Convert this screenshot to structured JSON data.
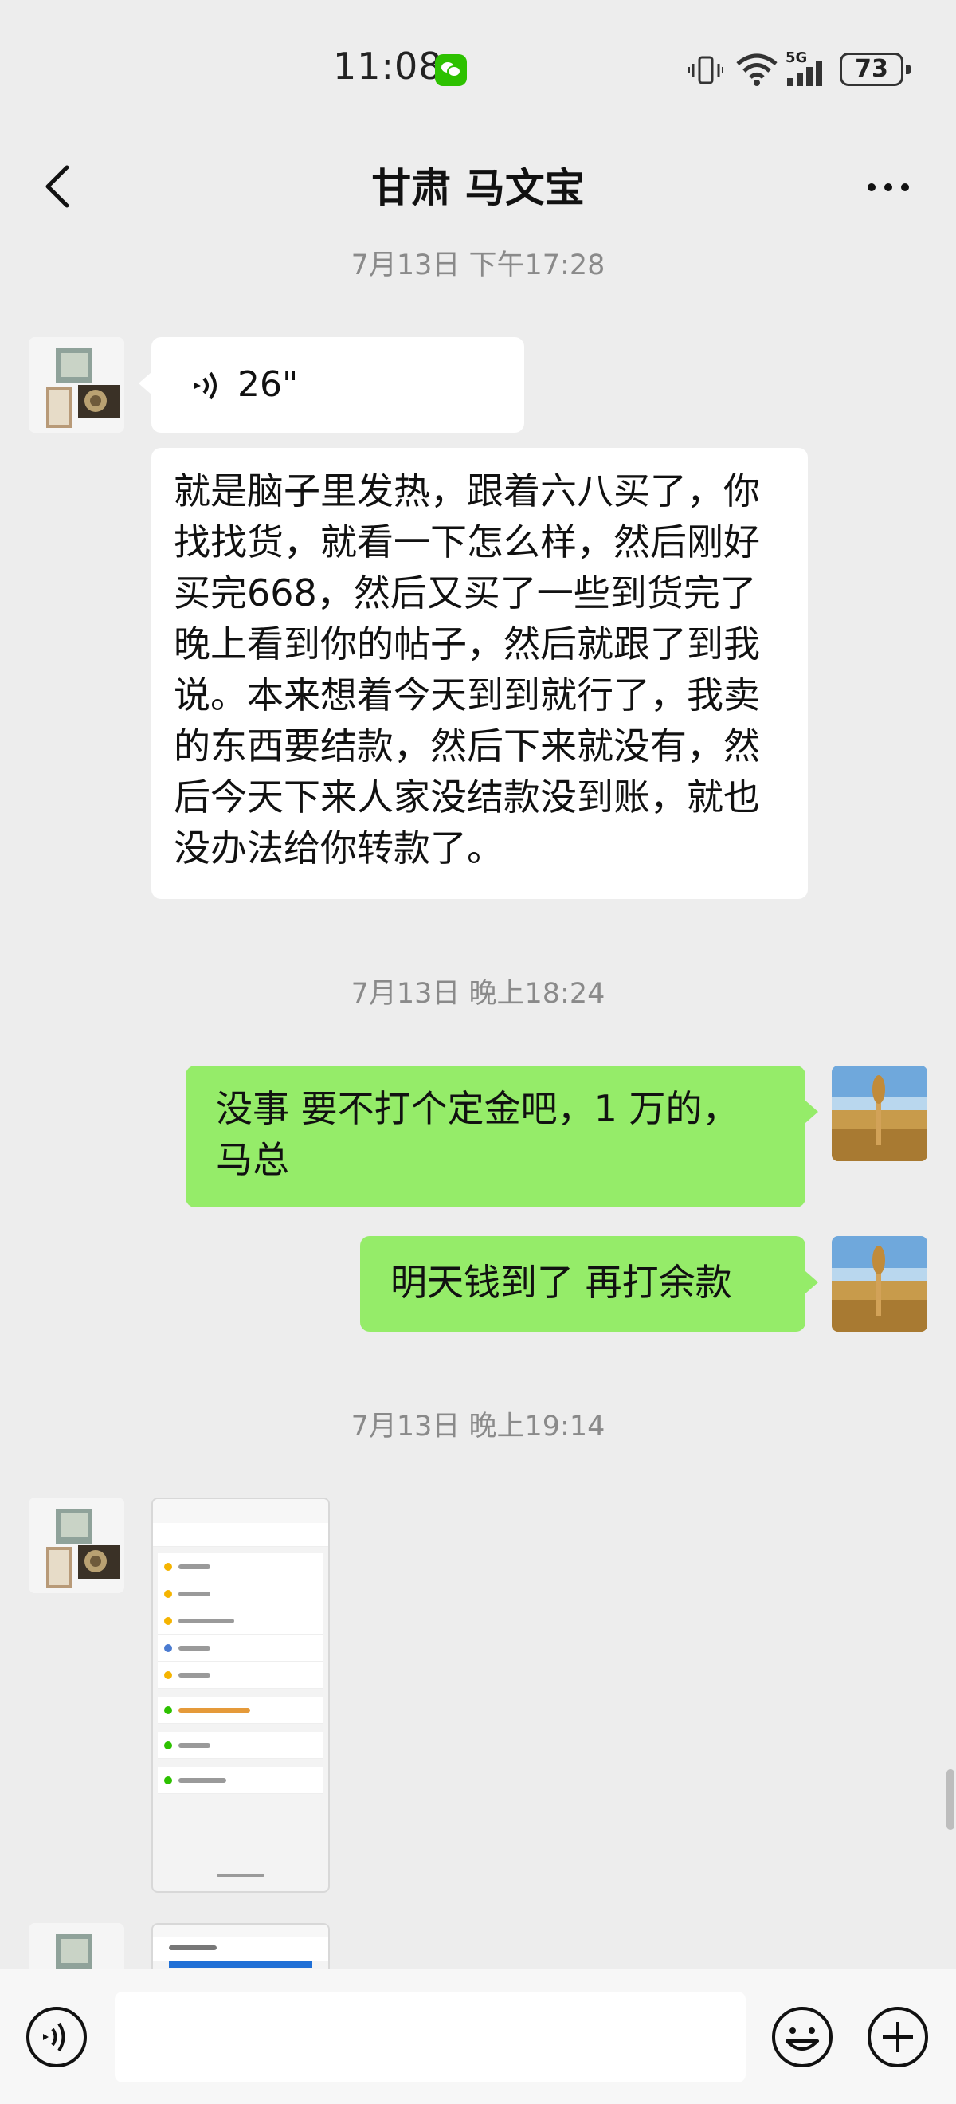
{
  "status_bar": {
    "time": "11:08",
    "network": "5G",
    "battery": "73"
  },
  "header": {
    "title": "甘肃 马文宝"
  },
  "messages": [
    {
      "kind": "timestamp",
      "text": "7月13日 下午17:28"
    },
    {
      "kind": "voice",
      "sender": "other",
      "duration": "26\""
    },
    {
      "kind": "text",
      "sender": "other",
      "text": "就是脑子里发热，跟着六八买了，你找找货，就看一下怎么样，然后刚好买完668，然后又买了一些到货完了晚上看到你的帖子，然后就跟了到我说。本来想着今天到到就行了，我卖的东西要结款，然后下来就没有，然后今天下来人家没结款没到账，就也没办法给你转款了。"
    },
    {
      "kind": "timestamp",
      "text": "7月13日 晚上18:24"
    },
    {
      "kind": "text",
      "sender": "me",
      "text": "没事   要不打个定金吧，1 万的，马总"
    },
    {
      "kind": "text",
      "sender": "me",
      "text": "明天钱到了  再打余款"
    },
    {
      "kind": "timestamp",
      "text": "7月13日 晚上19:14"
    },
    {
      "kind": "image",
      "sender": "other",
      "description": "wallet-screenshot"
    },
    {
      "kind": "image",
      "sender": "other",
      "description": "bank-screenshot"
    }
  ],
  "icons": {
    "back": "chevron-left-icon",
    "more": "more-dots-icon",
    "voice_input": "voice-icon",
    "emoji": "emoji-icon",
    "plus": "plus-icon"
  },
  "colors": {
    "background": "#ededed",
    "bubble_me": "#95ec69",
    "bubble_other": "#ffffff",
    "timestamp": "#8a8a8a",
    "wechat_green": "#2dc100"
  },
  "input": {
    "value": "",
    "placeholder": ""
  }
}
